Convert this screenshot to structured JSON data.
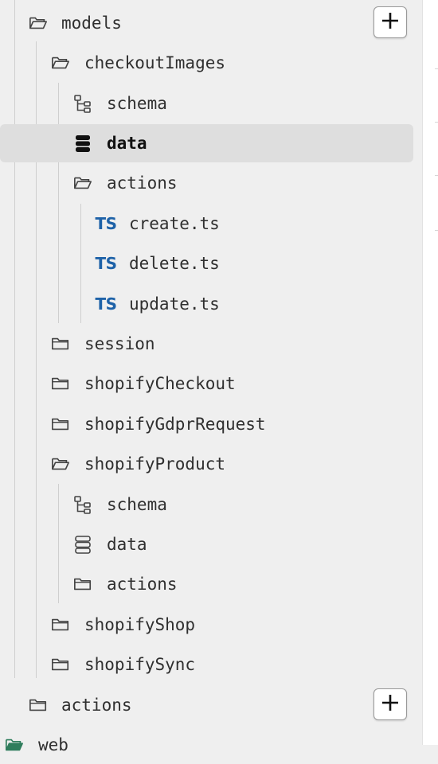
{
  "tree": {
    "root_items": [
      {
        "label": "models",
        "icon": "folder-open-icon"
      },
      {
        "label": "actions",
        "icon": "folder-icon"
      },
      {
        "label": "web",
        "icon": "folder-open-icon"
      }
    ],
    "models_children": [
      {
        "label": "checkoutImages",
        "icon": "folder-open-icon"
      },
      {
        "label": "schema",
        "icon": "schema-tree-icon"
      },
      {
        "label": "data",
        "icon": "database-icon",
        "selected": true
      },
      {
        "label": "actions",
        "icon": "folder-open-icon"
      },
      {
        "label": "create.ts",
        "icon": "typescript-icon"
      },
      {
        "label": "delete.ts",
        "icon": "typescript-icon"
      },
      {
        "label": "update.ts",
        "icon": "typescript-icon"
      },
      {
        "label": "session",
        "icon": "folder-icon"
      },
      {
        "label": "shopifyCheckout",
        "icon": "folder-icon"
      },
      {
        "label": "shopifyGdprRequest",
        "icon": "folder-icon"
      },
      {
        "label": "shopifyProduct",
        "icon": "folder-open-icon"
      },
      {
        "label": "schema",
        "icon": "schema-tree-icon"
      },
      {
        "label": "data",
        "icon": "database-icon"
      },
      {
        "label": "actions",
        "icon": "folder-icon"
      },
      {
        "label": "shopifyShop",
        "icon": "folder-icon"
      },
      {
        "label": "shopifySync",
        "icon": "folder-icon"
      }
    ],
    "ts_badge": "TS",
    "add_button_symbol": "+"
  },
  "colors": {
    "panel_bg": "#efefef",
    "selected_bg": "#dedede",
    "ts_blue": "#1e62a8",
    "web_icon_green": "#2f7d5c"
  }
}
